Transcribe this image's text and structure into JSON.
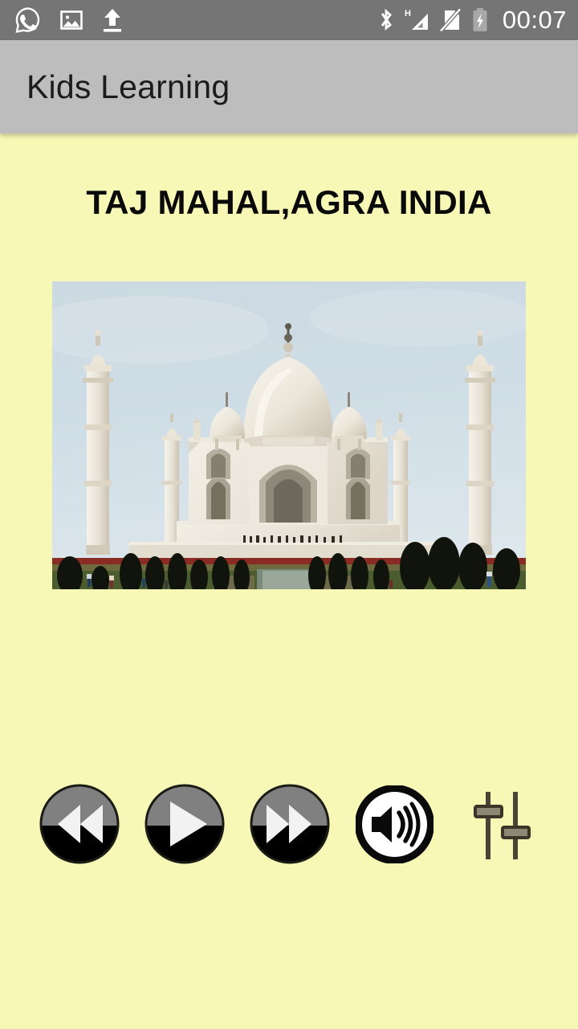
{
  "status_bar": {
    "left_icons": [
      {
        "name": "whatsapp-icon",
        "label": "WhatsApp notification"
      },
      {
        "name": "image-icon",
        "label": "Screenshot saved"
      },
      {
        "name": "upload-icon",
        "label": "Upload in progress"
      }
    ],
    "right_icons": [
      {
        "name": "bluetooth-icon",
        "label": "Bluetooth on"
      },
      {
        "name": "signal-h-icon",
        "label": "H mobile data signal"
      },
      {
        "name": "no-sim-icon",
        "label": "No SIM card"
      },
      {
        "name": "battery-charging-icon",
        "label": "Battery charging"
      }
    ],
    "time": "00:07",
    "background_color": "#757575",
    "icon_color": "#ffffff"
  },
  "app_bar": {
    "title": "Kids Learning",
    "background_color": "#bdbdbd",
    "text_color": "#1c1c1c"
  },
  "main": {
    "background_color": "#f7f8b5",
    "page_title": "TAJ MAHAL,AGRA INDIA",
    "page_title_color": "#0a0a0a",
    "photo": {
      "name": "taj-mahal-photo",
      "alt": "Taj Mahal monument in Agra India with minarets, gardens and reflecting pool"
    }
  },
  "controls": [
    {
      "name": "previous-button",
      "label": "Previous",
      "icon": "rewind-icon"
    },
    {
      "name": "play-button",
      "label": "Play",
      "icon": "play-icon"
    },
    {
      "name": "next-button",
      "label": "Next",
      "icon": "fast-forward-icon"
    },
    {
      "name": "volume-button",
      "label": "Volume",
      "icon": "speaker-icon"
    },
    {
      "name": "equalizer-button",
      "label": "Settings",
      "icon": "sliders-icon"
    }
  ],
  "colors": {
    "button_top": "#808080",
    "button_bottom": "#000000",
    "glyph": "#f2f2f2",
    "page_background": "#f7f8b5"
  }
}
